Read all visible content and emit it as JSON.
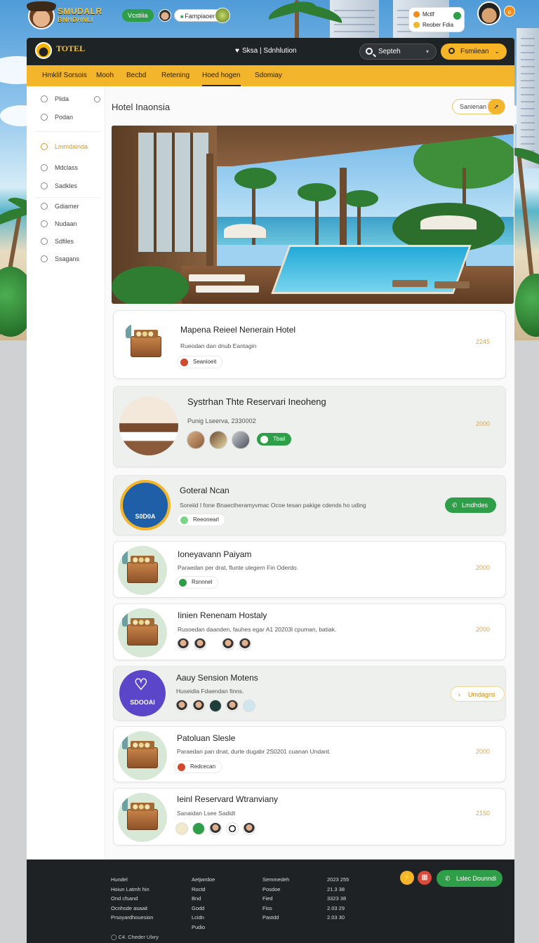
{
  "brand": {
    "line1": "SMUDALR",
    "line2": "BNHDHNLI"
  },
  "topbar": {
    "green_pill": "Vcstiiia",
    "white_pill": "Fampiaoen",
    "notif_rows": [
      "Mctlf",
      "Reober Fdia"
    ],
    "corner_badge": "e"
  },
  "navbar": {
    "logo_text": "TOTEL",
    "center_text": "Sksa | Sdnhlution",
    "search_label": "Septeh",
    "button_label": "Fsmiiean"
  },
  "tabs": [
    "Hmklif Sorsois",
    "Mooh",
    "Becbd",
    "Retening",
    "Hoed hogen",
    "Sdomiay"
  ],
  "active_tab": "Hoed hogen",
  "sidebar": {
    "items": [
      {
        "label": "Plida"
      },
      {
        "label": "Podan"
      },
      {
        "label": "Lmmdainda"
      },
      {
        "label": "Mdclass"
      },
      {
        "label": "Sadkles"
      },
      {
        "label": "Gdiamer"
      },
      {
        "label": "Nudaan"
      },
      {
        "label": "Sdfiles"
      },
      {
        "label": "Ssagans"
      }
    ]
  },
  "main": {
    "title": "Hotel Inaonsia",
    "title_button": "Sanienan"
  },
  "listings": [
    {
      "name": "Mapena Reieel Nenerain Hotel",
      "desc": "Rueodan dan dnub Eantagin",
      "chip": "Seanioeit",
      "price": "2245",
      "badge": ""
    },
    {
      "name": "Systrhan Thte Reservari Ineoheng",
      "desc": "Punig Lseerva, 2330002",
      "chip": "Tbail",
      "price": "2000",
      "badge": ""
    },
    {
      "name": "Goteral Ncan",
      "desc": "Soreiid I fone Bnaectheramyvmac Ocoe tesan pakige cdends ho uding",
      "chip": "Reeonearl",
      "price": "",
      "badge": "S0D0A",
      "action": "Lmdhdes"
    },
    {
      "name": "Ioneyavann Paiyam",
      "desc": "Paraedan per drat, flunte ulegern Fin Oderdo.",
      "chip": "Rsnnnel",
      "price": "2000",
      "badge": ""
    },
    {
      "name": "Iinien Renenam Hostaly",
      "desc": "Rusoedan daanden, fauhes egar A1 20203l cpuman, batiak.",
      "chip": "",
      "price": "2000",
      "badge": ""
    },
    {
      "name": "Aauy Sension Motens",
      "desc": "Huseidia Fdaendan finns.",
      "chip": "",
      "price": "",
      "badge": "SDOOAI",
      "action": "Umdagris"
    },
    {
      "name": "Patoluan Slesle",
      "desc": "Paraedan pan dnat, durte dugabr 2S0201 cuanan Undant.",
      "chip": "Redcecan",
      "price": "2000",
      "badge": ""
    },
    {
      "name": "Ieinl Reservard Wtranviany",
      "desc": "Sanaidan Lsee Sadidt",
      "chip": "",
      "price": "2150",
      "badge": ""
    }
  ],
  "footer": {
    "col1": [
      "Hundel",
      "Hoiun Latmh hin",
      "Ond cfsand",
      "Ocnhsde asaait",
      "Prsoyardhouesion"
    ],
    "col2": [
      "Aetjwrdoe",
      "Roctd",
      "Bnd",
      "Godd",
      "Lcidn",
      "Pudio"
    ],
    "col3": [
      "Semmedeh",
      "Posdoe",
      "Fied",
      "Fiss",
      "Pastdd"
    ],
    "col4": [
      "2023 255",
      "21.3 38",
      "3323 38",
      "2.03 29",
      "2.03 30"
    ],
    "button": "Lslec Dounndi",
    "copyright": "C4. Cheder Ulxry"
  },
  "colors": {
    "accent": "#f3b52c",
    "dark": "#1e2326",
    "green": "#2e9e48",
    "price": "#d9a652"
  }
}
